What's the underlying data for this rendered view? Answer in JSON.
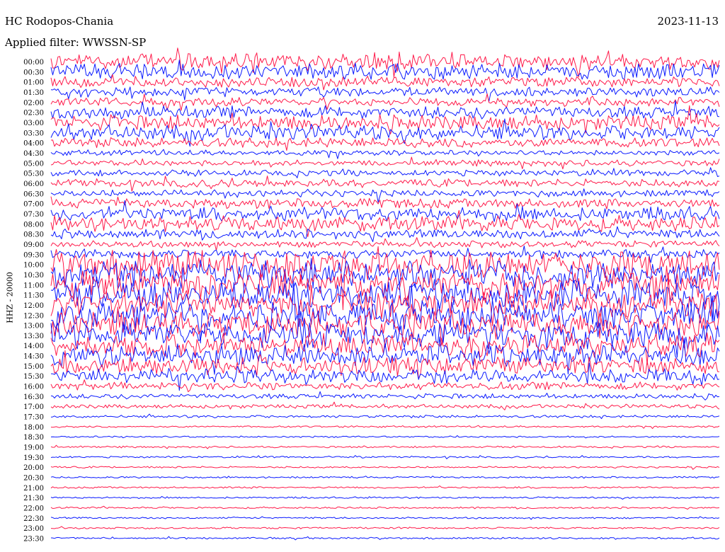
{
  "header": {
    "station": "HC Rodopos-Chania",
    "date": "2023-11-13",
    "filter": "Applied filter: WWSSN-SP"
  },
  "chart_data": {
    "type": "line",
    "title": "HC Rodopos-Chania",
    "ylabel": "HHZ - 20000",
    "colors": [
      "#ff1a4a",
      "#0a1aff"
    ],
    "grid": false,
    "rows": [
      {
        "time": "00:00",
        "amplitude": 1.0
      },
      {
        "time": "00:30",
        "amplitude": 0.9
      },
      {
        "time": "01:00",
        "amplitude": 0.6
      },
      {
        "time": "01:30",
        "amplitude": 0.55
      },
      {
        "time": "02:00",
        "amplitude": 0.5
      },
      {
        "time": "02:30",
        "amplitude": 0.7
      },
      {
        "time": "03:00",
        "amplitude": 0.85
      },
      {
        "time": "03:30",
        "amplitude": 0.85
      },
      {
        "time": "04:00",
        "amplitude": 0.55
      },
      {
        "time": "04:30",
        "amplitude": 0.3
      },
      {
        "time": "05:00",
        "amplitude": 0.35
      },
      {
        "time": "05:30",
        "amplitude": 0.35
      },
      {
        "time": "06:00",
        "amplitude": 0.45
      },
      {
        "time": "06:30",
        "amplitude": 0.4
      },
      {
        "time": "07:00",
        "amplitude": 0.55
      },
      {
        "time": "07:30",
        "amplitude": 0.8
      },
      {
        "time": "08:00",
        "amplitude": 0.85
      },
      {
        "time": "08:30",
        "amplitude": 0.55
      },
      {
        "time": "09:00",
        "amplitude": 0.4
      },
      {
        "time": "09:30",
        "amplitude": 0.5
      },
      {
        "time": "10:00",
        "amplitude": 1.6
      },
      {
        "time": "10:30",
        "amplitude": 1.6
      },
      {
        "time": "11:00",
        "amplitude": 1.6
      },
      {
        "time": "11:30",
        "amplitude": 1.6
      },
      {
        "time": "12:00",
        "amplitude": 1.6
      },
      {
        "time": "12:30",
        "amplitude": 1.6
      },
      {
        "time": "13:00",
        "amplitude": 1.5
      },
      {
        "time": "13:30",
        "amplitude": 1.5
      },
      {
        "time": "14:00",
        "amplitude": 1.3
      },
      {
        "time": "14:30",
        "amplitude": 1.2
      },
      {
        "time": "15:00",
        "amplitude": 1.0
      },
      {
        "time": "15:30",
        "amplitude": 0.8
      },
      {
        "time": "16:00",
        "amplitude": 0.45
      },
      {
        "time": "16:30",
        "amplitude": 0.28
      },
      {
        "time": "17:00",
        "amplitude": 0.22
      },
      {
        "time": "17:30",
        "amplitude": 0.15
      },
      {
        "time": "18:00",
        "amplitude": 0.1
      },
      {
        "time": "18:30",
        "amplitude": 0.1
      },
      {
        "time": "19:00",
        "amplitude": 0.1
      },
      {
        "time": "19:30",
        "amplitude": 0.1
      },
      {
        "time": "20:00",
        "amplitude": 0.1
      },
      {
        "time": "20:30",
        "amplitude": 0.1
      },
      {
        "time": "21:00",
        "amplitude": 0.1
      },
      {
        "time": "21:30",
        "amplitude": 0.1
      },
      {
        "time": "22:00",
        "amplitude": 0.1
      },
      {
        "time": "22:30",
        "amplitude": 0.1
      },
      {
        "time": "23:00",
        "amplitude": 0.1
      },
      {
        "time": "23:30",
        "amplitude": 0.1
      }
    ]
  }
}
